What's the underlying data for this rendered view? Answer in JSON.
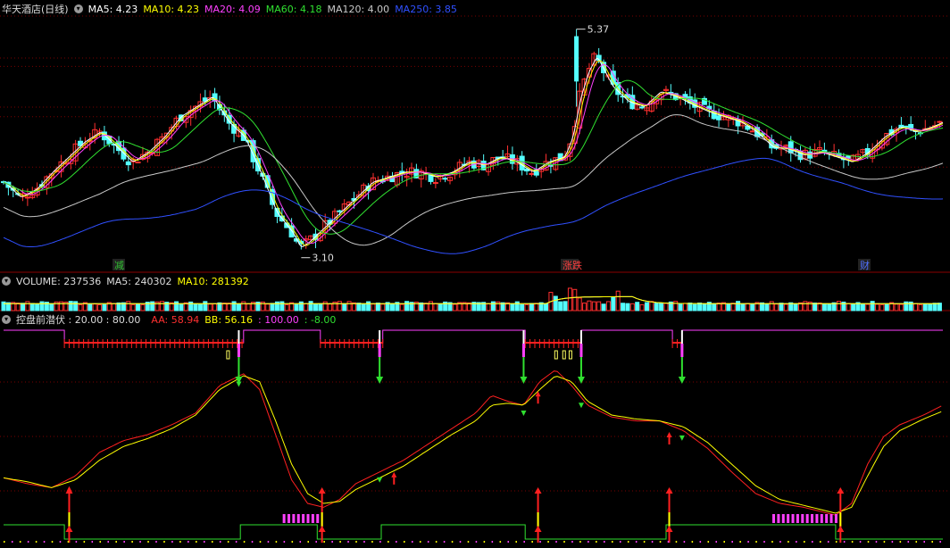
{
  "colors": {
    "background": "#000000",
    "grid": "#7a0000",
    "up": "#ff3030",
    "down": "#54ffff",
    "ma5": "#ffffff",
    "ma10": "#ffff00",
    "ma20": "#ff40ff",
    "ma60": "#30e030",
    "ma120": "#c8c8c8",
    "ma250": "#3050ff"
  },
  "price_panel": {
    "title": "华天酒店(日线)",
    "indicators": [
      {
        "label": "MA5: 4.23",
        "color": "#ffffff"
      },
      {
        "label": "MA10: 4.23",
        "color": "#ffff00"
      },
      {
        "label": "MA20: 4.09",
        "color": "#ff40ff"
      },
      {
        "label": "MA60: 4.18",
        "color": "#30e030"
      },
      {
        "label": "MA120: 4.00",
        "color": "#c8c8c8"
      },
      {
        "label": "MA250: 3.85",
        "color": "#3050ff"
      }
    ],
    "high_label": "5.37",
    "low_label": "3.10",
    "event_markers": [
      "减",
      "涨跌",
      "财"
    ]
  },
  "volume_panel": {
    "dropdown_icon": "chevron-down-icon",
    "indicators": [
      {
        "label": "VOLUME: 237536",
        "color": "#dddddd"
      },
      {
        "label": "MA5: 240302",
        "color": "#dddddd"
      },
      {
        "label": "MA10: 281392",
        "color": "#ffff00"
      }
    ]
  },
  "osc_panel": {
    "title": "控盘前潜伏 : 20.00 : 80.00",
    "indicators": [
      {
        "label": "AA: 58.94",
        "color": "#ff3030"
      },
      {
        "label": "BB: 56.16",
        "color": "#ffff00"
      },
      {
        "label": ": 100.00",
        "color": "#ff40ff"
      },
      {
        "label": ": -8.00",
        "color": "#30e030"
      }
    ]
  },
  "chart_data": {
    "type": "candlestick",
    "ylim": [
      3.0,
      5.5
    ],
    "high": 5.37,
    "low": 3.1,
    "close_points": [
      [
        0,
        3.85
      ],
      [
        10,
        3.7
      ],
      [
        20,
        3.78
      ],
      [
        30,
        3.95
      ],
      [
        40,
        4.1
      ],
      [
        50,
        4.25
      ],
      [
        60,
        4.35
      ],
      [
        70,
        4.2
      ],
      [
        80,
        4.05
      ],
      [
        90,
        4.15
      ],
      [
        100,
        4.3
      ],
      [
        110,
        4.5
      ],
      [
        120,
        4.6
      ],
      [
        130,
        4.7
      ],
      [
        140,
        4.45
      ],
      [
        150,
        4.3
      ],
      [
        160,
        3.95
      ],
      [
        170,
        3.55
      ],
      [
        180,
        3.35
      ],
      [
        185,
        3.2
      ],
      [
        190,
        3.25
      ],
      [
        200,
        3.4
      ],
      [
        210,
        3.55
      ],
      [
        220,
        3.7
      ],
      [
        230,
        3.85
      ],
      [
        240,
        3.9
      ],
      [
        250,
        3.95
      ],
      [
        260,
        3.95
      ],
      [
        270,
        3.9
      ],
      [
        280,
        3.95
      ],
      [
        290,
        4.05
      ],
      [
        300,
        4.02
      ],
      [
        310,
        4.1
      ],
      [
        320,
        4.05
      ],
      [
        330,
        3.95
      ],
      [
        340,
        4.05
      ],
      [
        350,
        4.1
      ],
      [
        355,
        4.3
      ],
      [
        360,
        4.7
      ],
      [
        365,
        4.95
      ],
      [
        370,
        5.1
      ],
      [
        375,
        4.95
      ],
      [
        380,
        4.8
      ],
      [
        390,
        4.65
      ],
      [
        400,
        4.6
      ],
      [
        410,
        4.75
      ],
      [
        420,
        4.7
      ],
      [
        430,
        4.62
      ],
      [
        440,
        4.55
      ],
      [
        450,
        4.5
      ],
      [
        460,
        4.45
      ],
      [
        470,
        4.35
      ],
      [
        480,
        4.2
      ],
      [
        490,
        4.18
      ],
      [
        500,
        4.12
      ],
      [
        510,
        4.15
      ],
      [
        520,
        4.1
      ],
      [
        530,
        4.05
      ],
      [
        540,
        4.15
      ],
      [
        550,
        4.3
      ],
      [
        560,
        4.4
      ],
      [
        570,
        4.35
      ],
      [
        580,
        4.4
      ],
      [
        587,
        4.45
      ]
    ],
    "ma_series": [
      {
        "name": "MA5",
        "color": "#ffffff",
        "offset": 0.0,
        "smooth": 2
      },
      {
        "name": "MA10",
        "color": "#ffff00",
        "offset": 0.0,
        "smooth": 5
      },
      {
        "name": "MA20",
        "color": "#ff40ff",
        "offset": 0.0,
        "smooth": 10
      },
      {
        "name": "MA60",
        "color": "#30e030",
        "offset": 0.0,
        "smooth": 30
      },
      {
        "name": "MA120",
        "color": "#c8c8c8",
        "offset": -0.25,
        "smooth": 60
      },
      {
        "name": "MA250",
        "color": "#3050ff",
        "offset": -0.55,
        "smooth": 120
      }
    ],
    "volume": {
      "ylim": [
        0,
        1
      ]
    },
    "oscillator": {
      "ylim": [
        0,
        110
      ],
      "aa": [
        [
          0,
          33
        ],
        [
          15,
          30
        ],
        [
          30,
          28
        ],
        [
          45,
          34
        ],
        [
          60,
          46
        ],
        [
          75,
          52
        ],
        [
          90,
          55
        ],
        [
          105,
          60
        ],
        [
          120,
          66
        ],
        [
          135,
          80
        ],
        [
          150,
          86
        ],
        [
          160,
          78
        ],
        [
          170,
          55
        ],
        [
          180,
          32
        ],
        [
          190,
          20
        ],
        [
          200,
          18
        ],
        [
          210,
          22
        ],
        [
          220,
          30
        ],
        [
          235,
          36
        ],
        [
          250,
          42
        ],
        [
          265,
          50
        ],
        [
          280,
          58
        ],
        [
          295,
          66
        ],
        [
          305,
          75
        ],
        [
          315,
          72
        ],
        [
          325,
          70
        ],
        [
          335,
          82
        ],
        [
          345,
          88
        ],
        [
          355,
          80
        ],
        [
          365,
          70
        ],
        [
          380,
          64
        ],
        [
          395,
          62
        ],
        [
          410,
          62
        ],
        [
          425,
          57
        ],
        [
          440,
          48
        ],
        [
          455,
          36
        ],
        [
          470,
          25
        ],
        [
          485,
          20
        ],
        [
          500,
          18
        ],
        [
          510,
          16
        ],
        [
          520,
          14
        ],
        [
          530,
          20
        ],
        [
          540,
          40
        ],
        [
          550,
          54
        ],
        [
          560,
          60
        ],
        [
          575,
          65
        ],
        [
          587,
          70
        ]
      ],
      "bb": [
        [
          0,
          33
        ],
        [
          15,
          31
        ],
        [
          30,
          28
        ],
        [
          45,
          32
        ],
        [
          60,
          42
        ],
        [
          75,
          49
        ],
        [
          90,
          53
        ],
        [
          105,
          58
        ],
        [
          120,
          65
        ],
        [
          135,
          78
        ],
        [
          150,
          85
        ],
        [
          160,
          82
        ],
        [
          170,
          62
        ],
        [
          180,
          40
        ],
        [
          190,
          25
        ],
        [
          200,
          20
        ],
        [
          210,
          21
        ],
        [
          220,
          27
        ],
        [
          235,
          33
        ],
        [
          250,
          39
        ],
        [
          265,
          47
        ],
        [
          280,
          55
        ],
        [
          295,
          62
        ],
        [
          305,
          70
        ],
        [
          315,
          71
        ],
        [
          325,
          70
        ],
        [
          335,
          78
        ],
        [
          345,
          85
        ],
        [
          355,
          82
        ],
        [
          365,
          72
        ],
        [
          380,
          65
        ],
        [
          395,
          63
        ],
        [
          410,
          62
        ],
        [
          425,
          59
        ],
        [
          440,
          51
        ],
        [
          455,
          40
        ],
        [
          470,
          29
        ],
        [
          485,
          22
        ],
        [
          500,
          19
        ],
        [
          510,
          17
        ],
        [
          520,
          15
        ],
        [
          530,
          18
        ],
        [
          540,
          34
        ],
        [
          550,
          49
        ],
        [
          560,
          57
        ],
        [
          575,
          63
        ],
        [
          587,
          67
        ]
      ],
      "down_signals": [
        147,
        235,
        325,
        361,
        424
      ],
      "up_signals": [
        41,
        244,
        334,
        416
      ],
      "bottom_arrows": [
        41,
        199,
        334,
        416,
        523
      ],
      "levels": [
        20,
        80
      ]
    }
  }
}
